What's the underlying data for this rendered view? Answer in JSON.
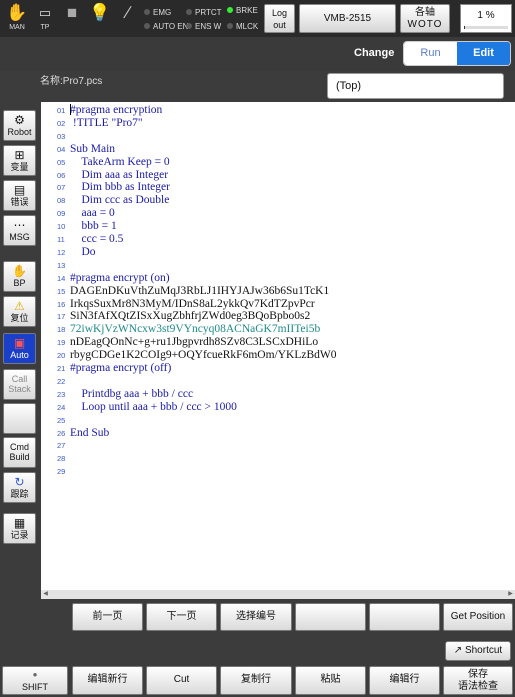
{
  "topbar": {
    "man_label": "MAN",
    "tp_label": "TP",
    "indicators": [
      {
        "label": "EMG",
        "on": false
      },
      {
        "label": "AUTO EN",
        "on": false
      },
      {
        "label": "PRTCT",
        "on": false
      },
      {
        "label": "ENS W",
        "on": false
      },
      {
        "label": "BRKE",
        "on": true
      },
      {
        "label": "MLCK",
        "on": false
      }
    ],
    "logout_line1": "Log",
    "logout_line2": "out",
    "robot_name": "VMB-2515",
    "axis_line1": "各轴",
    "axis_line2": "WOTO",
    "speed_text": "1 %",
    "speed_value": 1
  },
  "mode": {
    "change_label": "Change",
    "run_label": "Run",
    "edit_label": "Edit",
    "selected": "Edit"
  },
  "file": {
    "name_label": "名称:Pro7.pcs",
    "scope": "(Top)"
  },
  "sidebar": [
    {
      "label": "Robot",
      "icon": "robot-arm-icon",
      "glyph": "⚙"
    },
    {
      "label": "变量",
      "icon": "variable-icon",
      "glyph": "⊞"
    },
    {
      "label": "错误",
      "icon": "error-doc-icon",
      "glyph": "▤"
    },
    {
      "label": "MSG",
      "icon": "message-icon",
      "glyph": "⋯"
    },
    {
      "label": "BP",
      "icon": "hand-stop-icon",
      "glyph": "✋"
    },
    {
      "label": "复位",
      "icon": "warning-icon",
      "glyph": "⚠"
    },
    {
      "label": "Auto",
      "icon": "auto-icon",
      "glyph": "▣"
    },
    {
      "label": "Call",
      "label2": "Stack",
      "icon": "",
      "glyph": ""
    },
    {
      "label": "",
      "icon": "",
      "glyph": ""
    },
    {
      "label": "Cmd",
      "label2": "Build",
      "icon": "",
      "glyph": ""
    },
    {
      "label": "跟踪",
      "icon": "trace-icon",
      "glyph": "↻"
    },
    {
      "label": "记录",
      "icon": "record-icon",
      "glyph": "▦"
    }
  ],
  "code": [
    {
      "n": "01",
      "text": "#pragma encryption",
      "color": "blue"
    },
    {
      "n": "02",
      "text": " !TITLE \"Pro7\"",
      "color": "blue"
    },
    {
      "n": "03",
      "text": "",
      "color": "blue"
    },
    {
      "n": "04",
      "text": "Sub Main",
      "color": "blue"
    },
    {
      "n": "05",
      "text": "    TakeArm Keep = 0",
      "color": "blue"
    },
    {
      "n": "06",
      "text": "    Dim aaa as Integer",
      "color": "blue"
    },
    {
      "n": "07",
      "text": "    Dim bbb as Integer",
      "color": "blue"
    },
    {
      "n": "08",
      "text": "    Dim ccc as Double",
      "color": "blue"
    },
    {
      "n": "09",
      "text": "    aaa = 0",
      "color": "blue"
    },
    {
      "n": "10",
      "text": "    bbb = 1",
      "color": "blue"
    },
    {
      "n": "11",
      "text": "    ccc = 0.5",
      "color": "blue"
    },
    {
      "n": "12",
      "text": "    Do",
      "color": "blue"
    },
    {
      "n": "13",
      "text": "",
      "color": "blue"
    },
    {
      "n": "14",
      "text": "#pragma encrypt (on)",
      "color": "blue"
    },
    {
      "n": "15",
      "text": "DAGEnDKuVthZuMqJ3RbLJ1IHYJAJw36b6Su1TcK1",
      "color": "dark"
    },
    {
      "n": "16",
      "text": "IrkqsSuxMr8N3MyM/IDnS8aL2ykkQv7KdTZpvPcr",
      "color": "dark"
    },
    {
      "n": "17",
      "text": "SiN3fAfXQtZISxXugZbhfrjZWd0eg3BQoBpbo0s2",
      "color": "dark"
    },
    {
      "n": "18",
      "text": "72iwKjVzWNcxw3st9VYncyq08ACNaGK7mIITei5b",
      "color": "teal"
    },
    {
      "n": "19",
      "text": "nDEagQOnNc+g+ru1Jbgpvrdh8SZv8C3LSCxDHiLo",
      "color": "dark"
    },
    {
      "n": "20",
      "text": "rbygCDGe1K2COIg9+OQYfcueRkF6mOm/YKLzBdW0",
      "color": "dark"
    },
    {
      "n": "21",
      "text": "#pragma encrypt (off)",
      "color": "blue"
    },
    {
      "n": "22",
      "text": "",
      "color": "blue"
    },
    {
      "n": "23",
      "text": "    Printdbg aaa + bbb / ccc",
      "color": "blue"
    },
    {
      "n": "24",
      "text": "    Loop until aaa + bbb / ccc > 1000",
      "color": "blue"
    },
    {
      "n": "25",
      "text": "",
      "color": "blue"
    },
    {
      "n": "26",
      "text": "End Sub",
      "color": "blue"
    },
    {
      "n": "27",
      "text": "",
      "color": "blue"
    },
    {
      "n": "28",
      "text": "",
      "color": "blue"
    },
    {
      "n": "29",
      "text": "",
      "color": "blue"
    }
  ],
  "function_row1": [
    "前一页",
    "下一页",
    "选择编号",
    "",
    "",
    "Get Position"
  ],
  "shortcut_label": "Shortcut",
  "function_row2": [
    {
      "label": "SHIFT"
    },
    {
      "label": "编辑新行"
    },
    {
      "label": "Cut"
    },
    {
      "label": "复制行"
    },
    {
      "label": "粘贴"
    },
    {
      "label": "编辑行"
    },
    {
      "label": "保存",
      "label2": "语法检查"
    }
  ],
  "colors": {
    "accent": "#1e7ae0",
    "active_side": "#1a3fc8",
    "code_blue": "#1a1aa8",
    "line_number": "#3a58c8"
  }
}
